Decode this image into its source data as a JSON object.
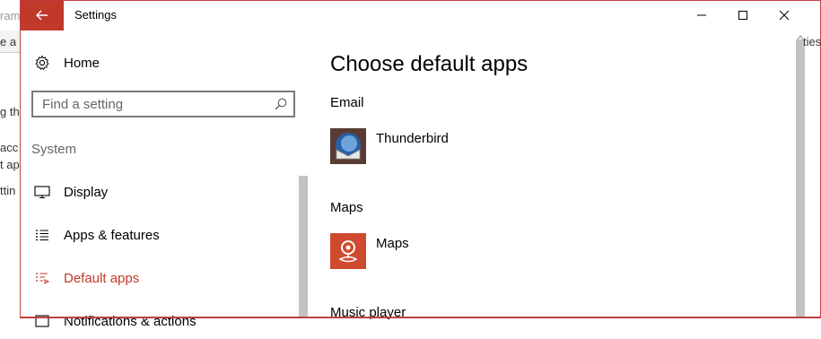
{
  "background_fragments": [
    "ram",
    "e a p",
    "ties",
    "g th",
    "acc",
    "t ap",
    "ttin"
  ],
  "window": {
    "title": "Settings",
    "accent_color": "#c0392b"
  },
  "sidebar": {
    "home_label": "Home",
    "search_placeholder": "Find a setting",
    "section_label": "System",
    "items": [
      {
        "label": "Display",
        "icon": "monitor-icon",
        "active": false
      },
      {
        "label": "Apps & features",
        "icon": "list-icon",
        "active": false
      },
      {
        "label": "Default apps",
        "icon": "default-apps-icon",
        "active": true
      },
      {
        "label": "Notifications & actions",
        "icon": "notifications-icon",
        "active": false
      }
    ]
  },
  "main": {
    "title": "Choose default apps",
    "categories": [
      {
        "label": "Email",
        "app": "Thunderbird",
        "icon": "thunderbird-icon"
      },
      {
        "label": "Maps",
        "app": "Maps",
        "icon": "maps-icon"
      },
      {
        "label": "Music player",
        "app": "",
        "icon": ""
      }
    ]
  },
  "colors": {
    "accent": "#c0392b",
    "maps_tile": "#d04a2f",
    "scrollbar": "#c2c2c2"
  }
}
